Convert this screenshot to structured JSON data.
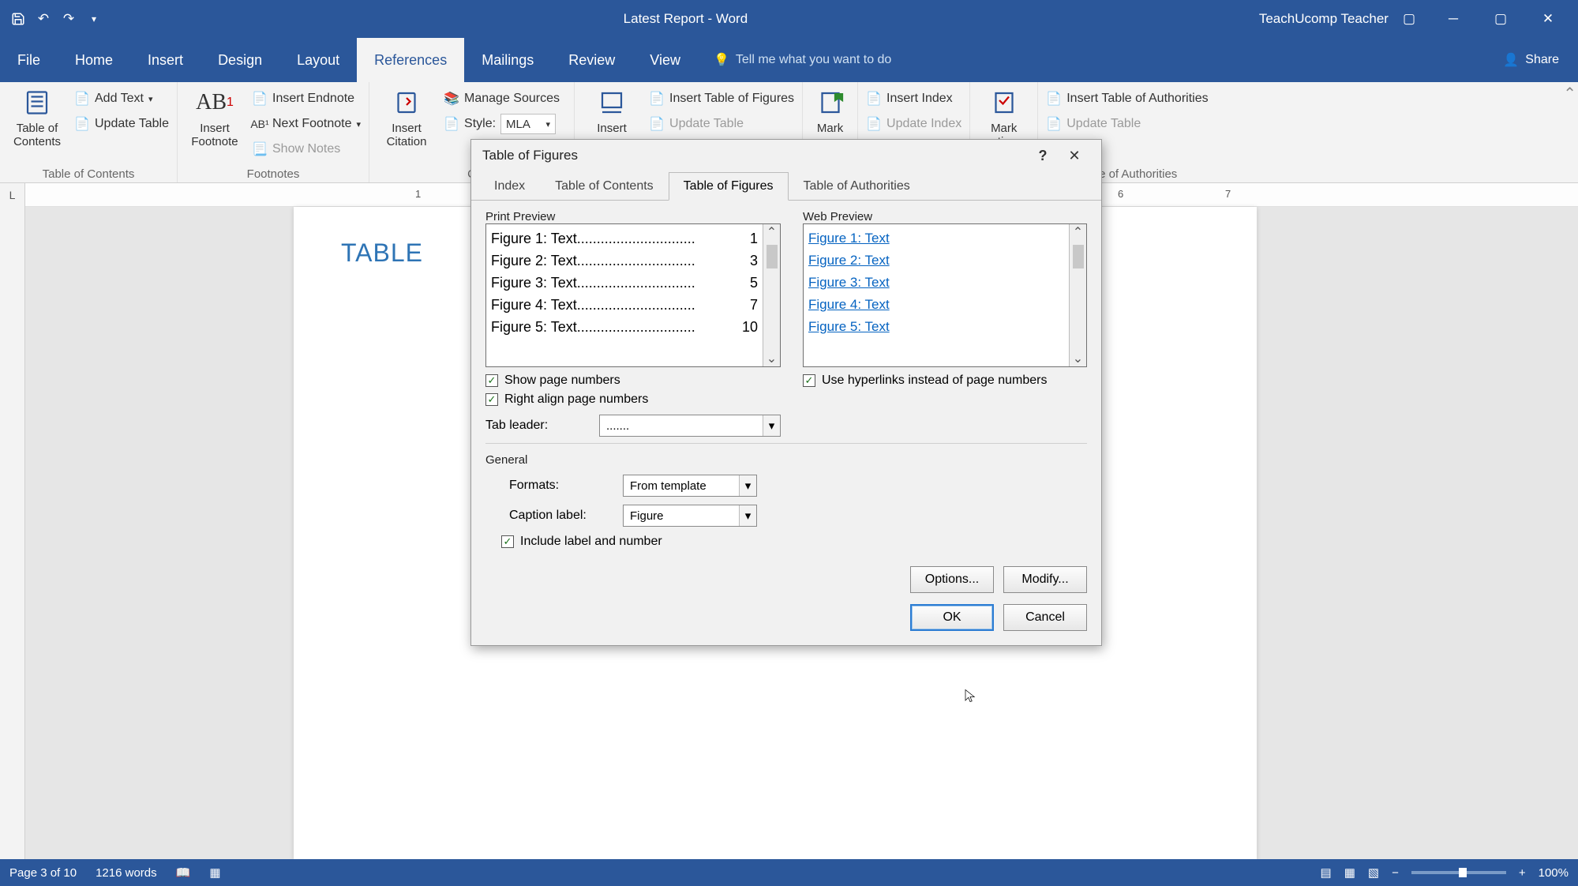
{
  "titlebar": {
    "doc_title": "Latest Report - Word",
    "user": "TeachUcomp Teacher"
  },
  "ribbon_tabs": [
    "File",
    "Home",
    "Insert",
    "Design",
    "Layout",
    "References",
    "Mailings",
    "Review",
    "View"
  ],
  "ribbon_active": "References",
  "tell_me": "Tell me what you want to do",
  "share": "Share",
  "ribbon": {
    "toc": {
      "big": "Table of\nContents",
      "add_text": "Add Text",
      "update": "Update Table",
      "group": "Table of Contents"
    },
    "footnotes": {
      "big": "Insert\nFootnote",
      "endnote": "Insert Endnote",
      "next": "Next Footnote",
      "show": "Show Notes",
      "group": "Footnotes"
    },
    "citations": {
      "big": "Insert\nCitation",
      "manage": "Manage Sources",
      "style_label": "Style:",
      "style_value": "MLA",
      "group": "C"
    },
    "captions": {
      "big": "Insert",
      "insert_tof": "Insert Table of Figures",
      "update": "Update Table"
    },
    "mark": {
      "big": "Mark"
    },
    "index": {
      "insert": "Insert Index",
      "update": "Update Index"
    },
    "mark2": {
      "big": "Mark",
      "suffix": "ation"
    },
    "toa": {
      "insert": "Insert Table of Authorities",
      "update": "Update Table",
      "group": "Table of Authorities"
    }
  },
  "page": {
    "heading": "TABLE"
  },
  "statusbar": {
    "page": "Page 3 of 10",
    "words": "1216 words",
    "zoom": "100%"
  },
  "ruler_nums": [
    "1",
    "6",
    "7"
  ],
  "dialog": {
    "title": "Table of Figures",
    "tabs": [
      "Index",
      "Table of Contents",
      "Table of Figures",
      "Table of Authorities"
    ],
    "active_tab": "Table of Figures",
    "print_preview_label": "Print Preview",
    "web_preview_label": "Web Preview",
    "print_lines": [
      {
        "text": "Figure 1: Text",
        "page": "1"
      },
      {
        "text": "Figure 2: Text",
        "page": "3"
      },
      {
        "text": "Figure 3: Text",
        "page": "5"
      },
      {
        "text": "Figure 4: Text",
        "page": "7"
      },
      {
        "text": "Figure 5: Text",
        "page": "10"
      }
    ],
    "web_lines": [
      "Figure 1: Text",
      "Figure 2: Text",
      "Figure 3: Text",
      "Figure 4: Text",
      "Figure 5: Text"
    ],
    "chk_show_pages": "Show page numbers",
    "chk_right_align": "Right align page numbers",
    "chk_hyperlinks": "Use hyperlinks instead of page numbers",
    "tab_leader_label": "Tab leader:",
    "tab_leader_value": ".......",
    "general_label": "General",
    "formats_label": "Formats:",
    "formats_value": "From template",
    "caption_label_label": "Caption label:",
    "caption_label_value": "Figure",
    "chk_include": "Include label and number",
    "options": "Options...",
    "modify": "Modify...",
    "ok": "OK",
    "cancel": "Cancel"
  }
}
